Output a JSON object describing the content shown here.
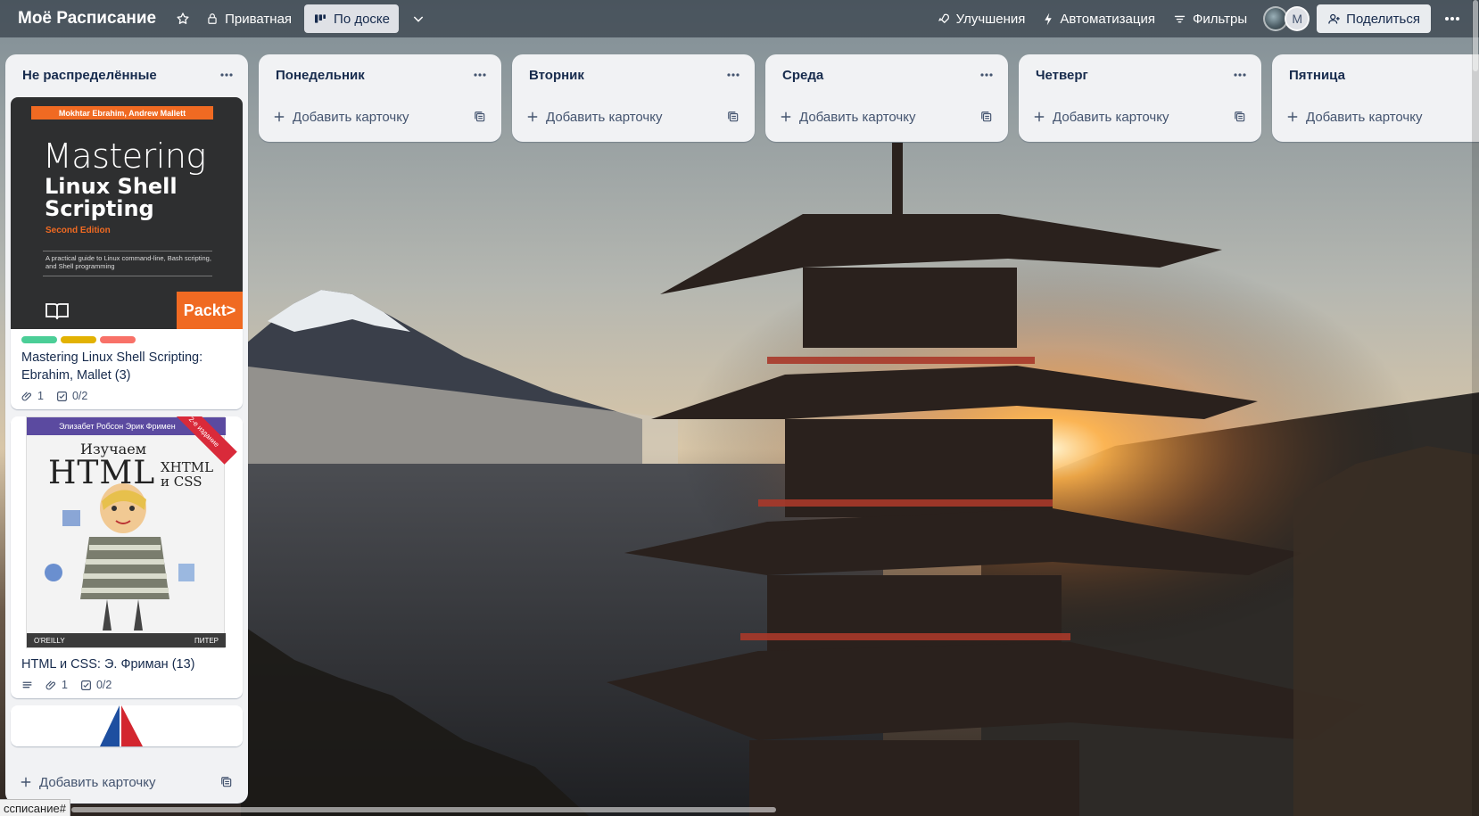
{
  "board": {
    "title": "Моё Расписание",
    "visibility": "Приватная",
    "view": "По доске",
    "powerups": "Улучшения",
    "automation": "Автоматизация",
    "filters": "Фильтры",
    "member_initial": "M",
    "share": "Поделиться"
  },
  "lists": [
    {
      "title": "Не распределённые",
      "add_label": "Добавить карточку",
      "cards": [
        {
          "title": "Mastering Linux Shell Scripting: Ebrahim, Mallet (3)",
          "labels": [
            "#4bce97",
            "#e2b203",
            "#f87168"
          ],
          "attachments": "1",
          "checklist": "0/2",
          "cover": {
            "authors": "Mokhtar Ebrahim, Andrew Mallett",
            "line1": "Mastering",
            "line2": "Linux Shell",
            "line3": "Scripting",
            "edition": "Second Edition",
            "subtitle": "A practical guide to Linux command-line, Bash scripting, and Shell programming",
            "publisher": "Packt>"
          }
        },
        {
          "title": "HTML и CSS: Э. Фриман (13)",
          "attachments": "1",
          "checklist": "0/2",
          "cover": {
            "authors": "Элизабет Робсон  Эрик Фримен",
            "ribbon": "2-е издание",
            "line1": "Изучаем",
            "line2": "HTML",
            "line3a": "XHTML",
            "line3b": "и CSS",
            "footer_left": "O'REILLY",
            "footer_right": "ПИТЕР"
          }
        }
      ]
    },
    {
      "title": "Понедельник",
      "add_label": "Добавить карточку"
    },
    {
      "title": "Вторник",
      "add_label": "Добавить карточку"
    },
    {
      "title": "Среда",
      "add_label": "Добавить карточку"
    },
    {
      "title": "Четверг",
      "add_label": "Добавить карточку"
    },
    {
      "title": "Пятница",
      "add_label": "Добавить карточку"
    }
  ],
  "status_bar": "ссписание#",
  "colors": {
    "list_bg": "#f1f2f4",
    "header_overlay": "#36404a",
    "active_view": "#dfe1e6"
  }
}
